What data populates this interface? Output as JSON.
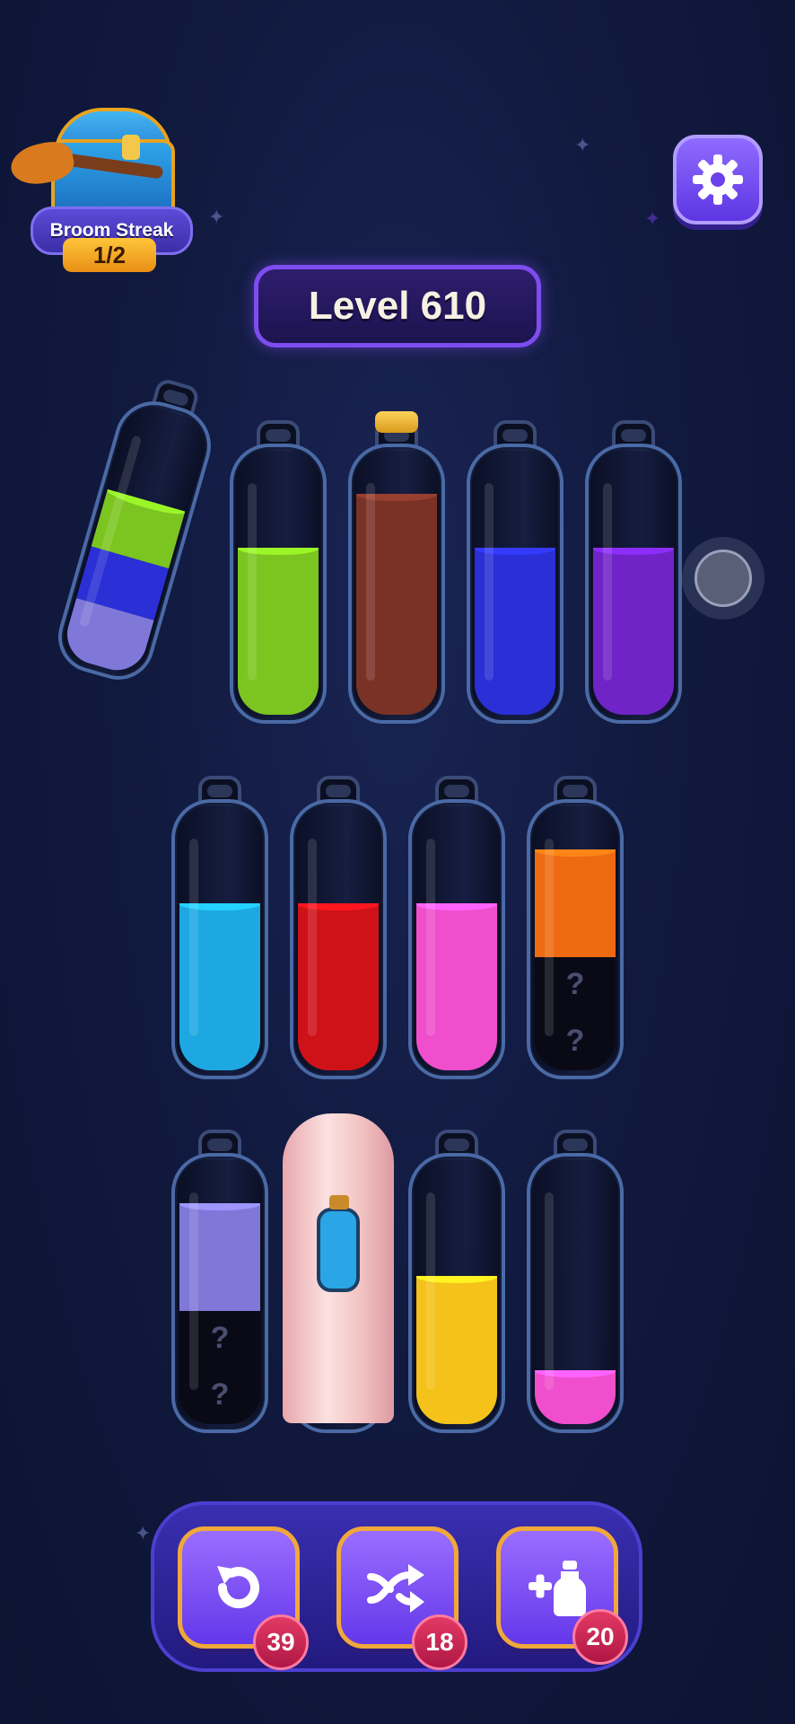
{
  "streak": {
    "title": "Broom Streak",
    "count": "1/2"
  },
  "level": {
    "label": "Level 610"
  },
  "mystery_mark": "?",
  "colors": {
    "green": "#7cc520",
    "blue": "#2a2fd6",
    "lavender": "#7f78d8",
    "brown": "#7a3226",
    "purple": "#7024c7",
    "cyan": "#1da8e2",
    "red": "#cf1218",
    "pink": "#ef4fcc",
    "orange": "#ee6a12",
    "yellow": "#f4c21a",
    "hidden": "#0a0a16"
  },
  "bottles": [
    {
      "id": "b1",
      "tilted": true,
      "layers": [
        {
          "color": "lavender",
          "fraction": 0.22
        },
        {
          "color": "blue",
          "fraction": 0.2
        },
        {
          "color": "green",
          "fraction": 0.22
        }
      ]
    },
    {
      "id": "b2",
      "layers": [
        {
          "color": "green",
          "fraction": 0.62
        }
      ]
    },
    {
      "id": "b3",
      "corked": true,
      "layers": [
        {
          "color": "brown",
          "fraction": 0.82
        }
      ]
    },
    {
      "id": "b4",
      "layers": [
        {
          "color": "blue",
          "fraction": 0.62
        }
      ]
    },
    {
      "id": "b5",
      "layers": [
        {
          "color": "purple",
          "fraction": 0.62
        }
      ]
    },
    {
      "id": "b6",
      "layers": [
        {
          "color": "cyan",
          "fraction": 0.62
        }
      ]
    },
    {
      "id": "b7",
      "layers": [
        {
          "color": "red",
          "fraction": 0.62
        }
      ]
    },
    {
      "id": "b8",
      "layers": [
        {
          "color": "pink",
          "fraction": 0.62
        }
      ]
    },
    {
      "id": "b9",
      "layers": [
        {
          "color": "hidden",
          "fraction": 0.22,
          "mystery": true
        },
        {
          "color": "hidden",
          "fraction": 0.2,
          "mystery": true
        },
        {
          "color": "orange",
          "fraction": 0.4
        }
      ]
    },
    {
      "id": "b10",
      "layers": [
        {
          "color": "hidden",
          "fraction": 0.22,
          "mystery": true
        },
        {
          "color": "hidden",
          "fraction": 0.2,
          "mystery": true
        },
        {
          "color": "lavender",
          "fraction": 0.4
        }
      ]
    },
    {
      "id": "b11",
      "covered": true,
      "layers": []
    },
    {
      "id": "b12",
      "layers": [
        {
          "color": "yellow",
          "fraction": 0.55
        }
      ]
    },
    {
      "id": "b13",
      "layers": [
        {
          "color": "pink",
          "fraction": 0.2
        }
      ]
    }
  ],
  "toolbar": {
    "undo": {
      "icon": "undo-icon",
      "count": "39"
    },
    "shuffle": {
      "icon": "shuffle-icon",
      "count": "18"
    },
    "add_bottle": {
      "icon": "add-bottle-icon",
      "count": "20"
    }
  }
}
